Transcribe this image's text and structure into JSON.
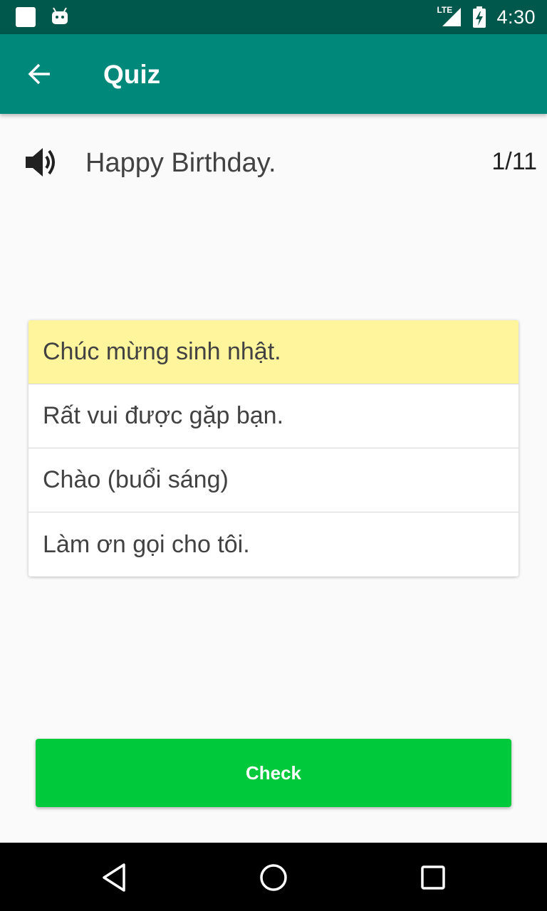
{
  "status_bar": {
    "time": "4:30",
    "network": "LTE"
  },
  "app_bar": {
    "title": "Quiz"
  },
  "question": {
    "text": "Happy Birthday.",
    "counter": "1/11"
  },
  "answers": [
    {
      "label": "Chúc mừng sinh nhật.",
      "selected": true
    },
    {
      "label": "Rất vui được gặp bạn.",
      "selected": false
    },
    {
      "label": "Chào (buổi sáng)",
      "selected": false
    },
    {
      "label": "Làm ơn gọi cho tôi.",
      "selected": false
    }
  ],
  "check_button": {
    "label": "Check"
  },
  "colors": {
    "status_bar": "#00574b",
    "app_bar": "#00897b",
    "selected_answer": "#fff59d",
    "check_button": "#00c93c"
  },
  "icons": {
    "back": "arrow-back-icon",
    "speaker": "volume-up-icon",
    "nav_back": "triangle-back-icon",
    "nav_home": "circle-home-icon",
    "nav_recents": "square-recents-icon"
  }
}
